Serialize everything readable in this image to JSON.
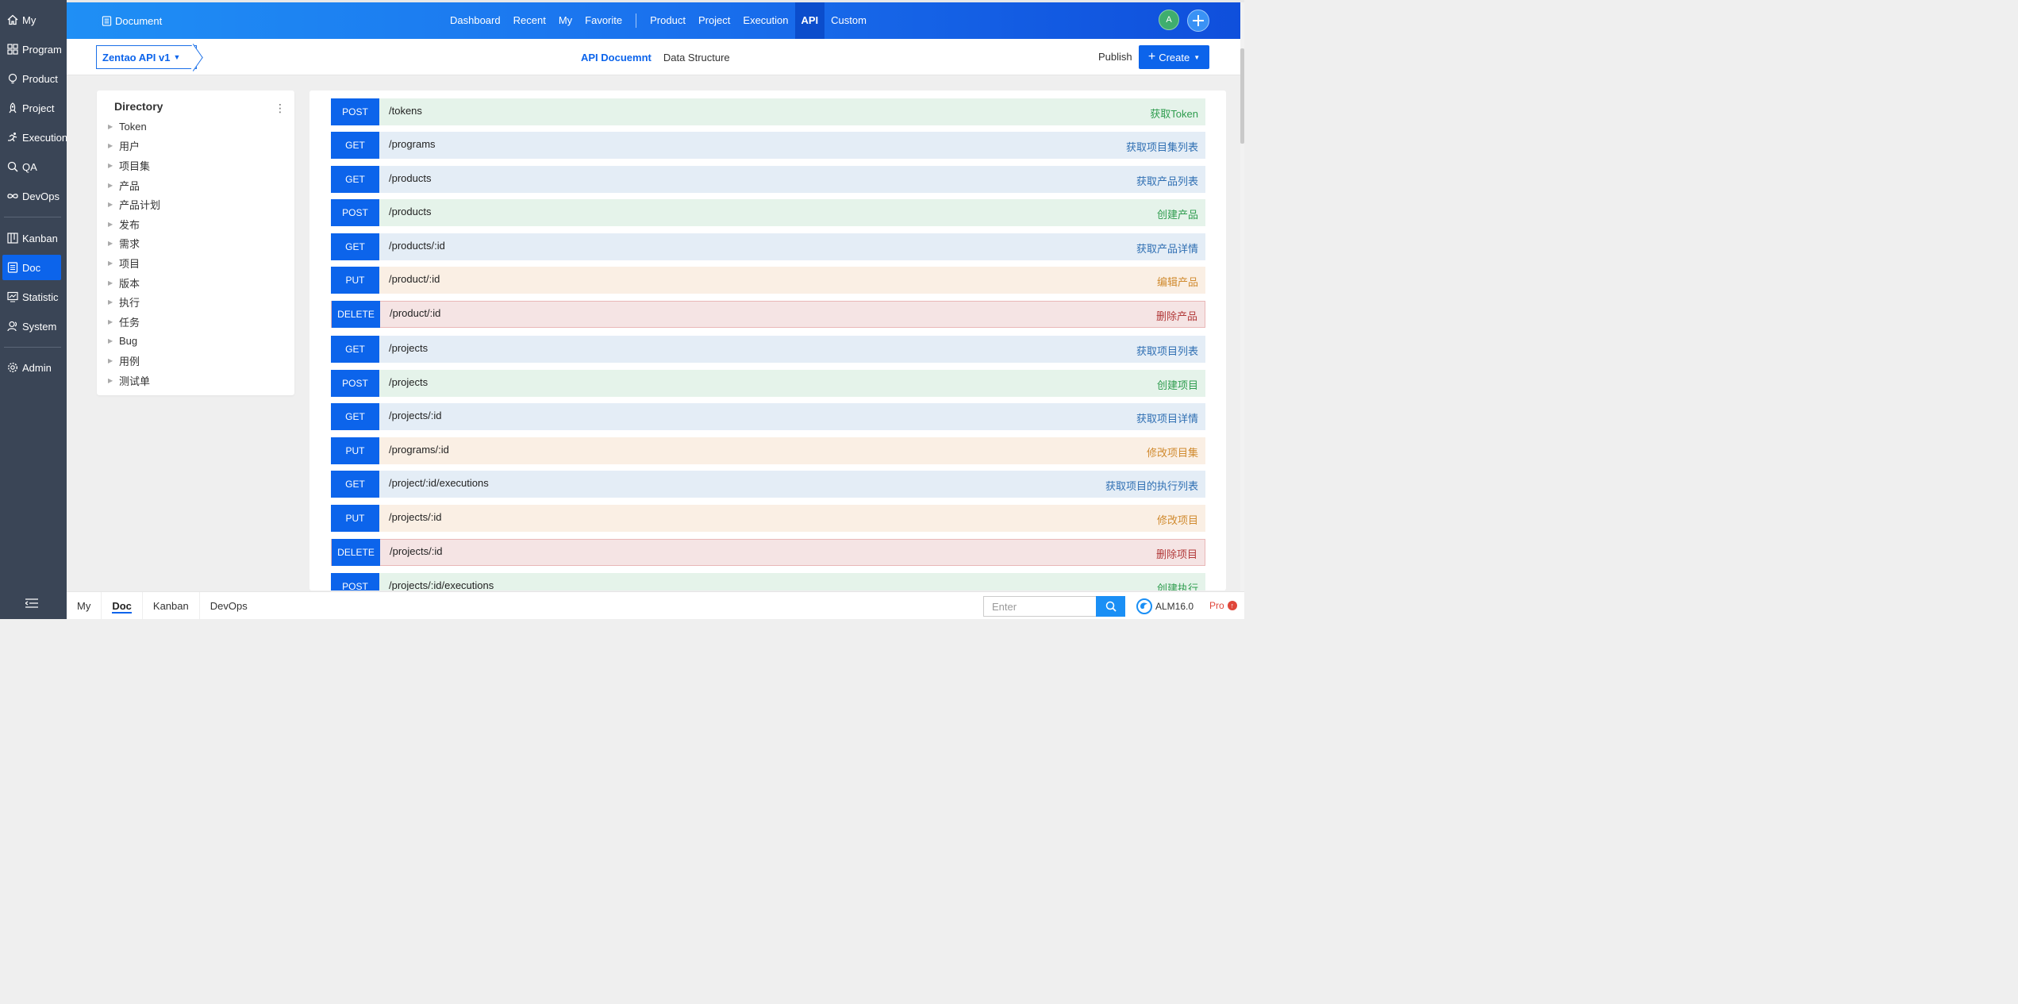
{
  "sidebar": {
    "items": [
      {
        "label": "My",
        "icon": "home-icon"
      },
      {
        "label": "Program",
        "icon": "grid-icon"
      },
      {
        "label": "Product",
        "icon": "bulb-icon"
      },
      {
        "label": "Project",
        "icon": "rocket-icon"
      },
      {
        "label": "Execution",
        "icon": "runner-icon"
      },
      {
        "label": "QA",
        "icon": "search-bug-icon"
      },
      {
        "label": "DevOps",
        "icon": "infinity-icon"
      },
      {
        "label": "Kanban",
        "icon": "kanban-icon"
      },
      {
        "label": "Doc",
        "icon": "doc-icon",
        "active": true
      },
      {
        "label": "Statistic",
        "icon": "monitor-icon"
      },
      {
        "label": "System",
        "icon": "users-icon"
      },
      {
        "label": "Admin",
        "icon": "gear-icon"
      }
    ]
  },
  "header": {
    "app_label": "Document",
    "nav_left": [
      "Dashboard",
      "Recent",
      "My",
      "Favorite"
    ],
    "nav_right": [
      "Product",
      "Project",
      "Execution",
      "API",
      "Custom"
    ],
    "active_nav": "API",
    "avatar_initial": "A"
  },
  "subheader": {
    "library": "Zentao API v1",
    "tabs": [
      "API Docuemnt",
      "Data Structure"
    ],
    "publish": "Publish",
    "create": "Create"
  },
  "directory": {
    "title": "Directory",
    "items": [
      "Token",
      "用户",
      "项目集",
      "产品",
      "产品计划",
      "发布",
      "需求",
      "项目",
      "版本",
      "执行",
      "任务",
      "Bug",
      "用例",
      "测试单"
    ]
  },
  "apis": [
    {
      "method": "POST",
      "path": "/tokens",
      "desc": "获取Token"
    },
    {
      "method": "GET",
      "path": "/programs",
      "desc": "获取项目集列表"
    },
    {
      "method": "GET",
      "path": "/products",
      "desc": "获取产品列表"
    },
    {
      "method": "POST",
      "path": "/products",
      "desc": "创建产品"
    },
    {
      "method": "GET",
      "path": "/products/:id",
      "desc": "获取产品详情"
    },
    {
      "method": "PUT",
      "path": "/product/:id",
      "desc": "编辑产品"
    },
    {
      "method": "DELETE",
      "path": "/product/:id",
      "desc": "删除产品"
    },
    {
      "method": "GET",
      "path": "/projects",
      "desc": "获取项目列表"
    },
    {
      "method": "POST",
      "path": "/projects",
      "desc": "创建项目"
    },
    {
      "method": "GET",
      "path": "/projects/:id",
      "desc": "获取项目详情"
    },
    {
      "method": "PUT",
      "path": "/programs/:id",
      "desc": "修改项目集"
    },
    {
      "method": "GET",
      "path": "/project/:id/executions",
      "desc": "获取项目的执行列表"
    },
    {
      "method": "PUT",
      "path": "/projects/:id",
      "desc": "修改项目"
    },
    {
      "method": "DELETE",
      "path": "/projects/:id",
      "desc": "删除项目"
    },
    {
      "method": "POST",
      "path": "/projects/:id/executions",
      "desc": "创建执行"
    }
  ],
  "bottom": {
    "tabs": [
      "My",
      "Doc",
      "Kanban",
      "DevOps"
    ],
    "active_tab": "Doc",
    "search_placeholder": "Enter",
    "version": "ALM16.0",
    "edition": "Pro"
  },
  "colors": {
    "accent": "#0c64eb",
    "sidebar_bg": "#3a4556",
    "get_bg": "#e4edf6",
    "post_bg": "#e5f3ea",
    "put_bg": "#faefe4",
    "delete_bg": "#f5e4e4"
  }
}
